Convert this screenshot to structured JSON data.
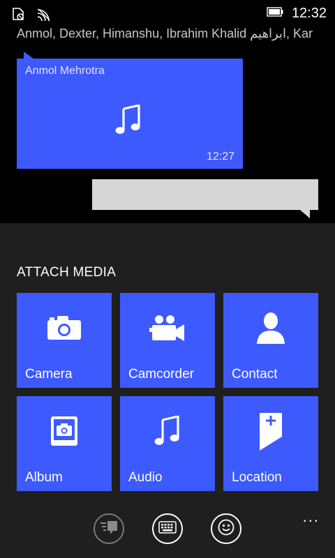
{
  "status": {
    "time": "12:32"
  },
  "conversation": {
    "participants": "Anmol, Dexter, Himanshu, Ibrahim Khalid ابراهيم, Kar",
    "incoming": {
      "sender": "Anmol Mehrotra",
      "time": "12:27",
      "content_icon": "music-note-icon"
    },
    "outgoing": {
      "text": ""
    }
  },
  "attach": {
    "title": "ATTACH MEDIA",
    "tiles": [
      {
        "label": "Camera",
        "icon": "camera-icon"
      },
      {
        "label": "Camcorder",
        "icon": "camcorder-icon"
      },
      {
        "label": "Contact",
        "icon": "contact-icon"
      },
      {
        "label": "Album",
        "icon": "album-icon"
      },
      {
        "label": "Audio",
        "icon": "music-note-icon"
      },
      {
        "label": "Location",
        "icon": "location-pin-icon"
      }
    ]
  },
  "appbar": {
    "buttons": [
      "quick-reply-icon",
      "keyboard-icon",
      "emoji-icon"
    ],
    "more": "..."
  },
  "colors": {
    "accent": "#3d5afe",
    "panel": "#1f1f1f",
    "background": "#000000",
    "outgoing_bubble": "#d6d6d6"
  }
}
